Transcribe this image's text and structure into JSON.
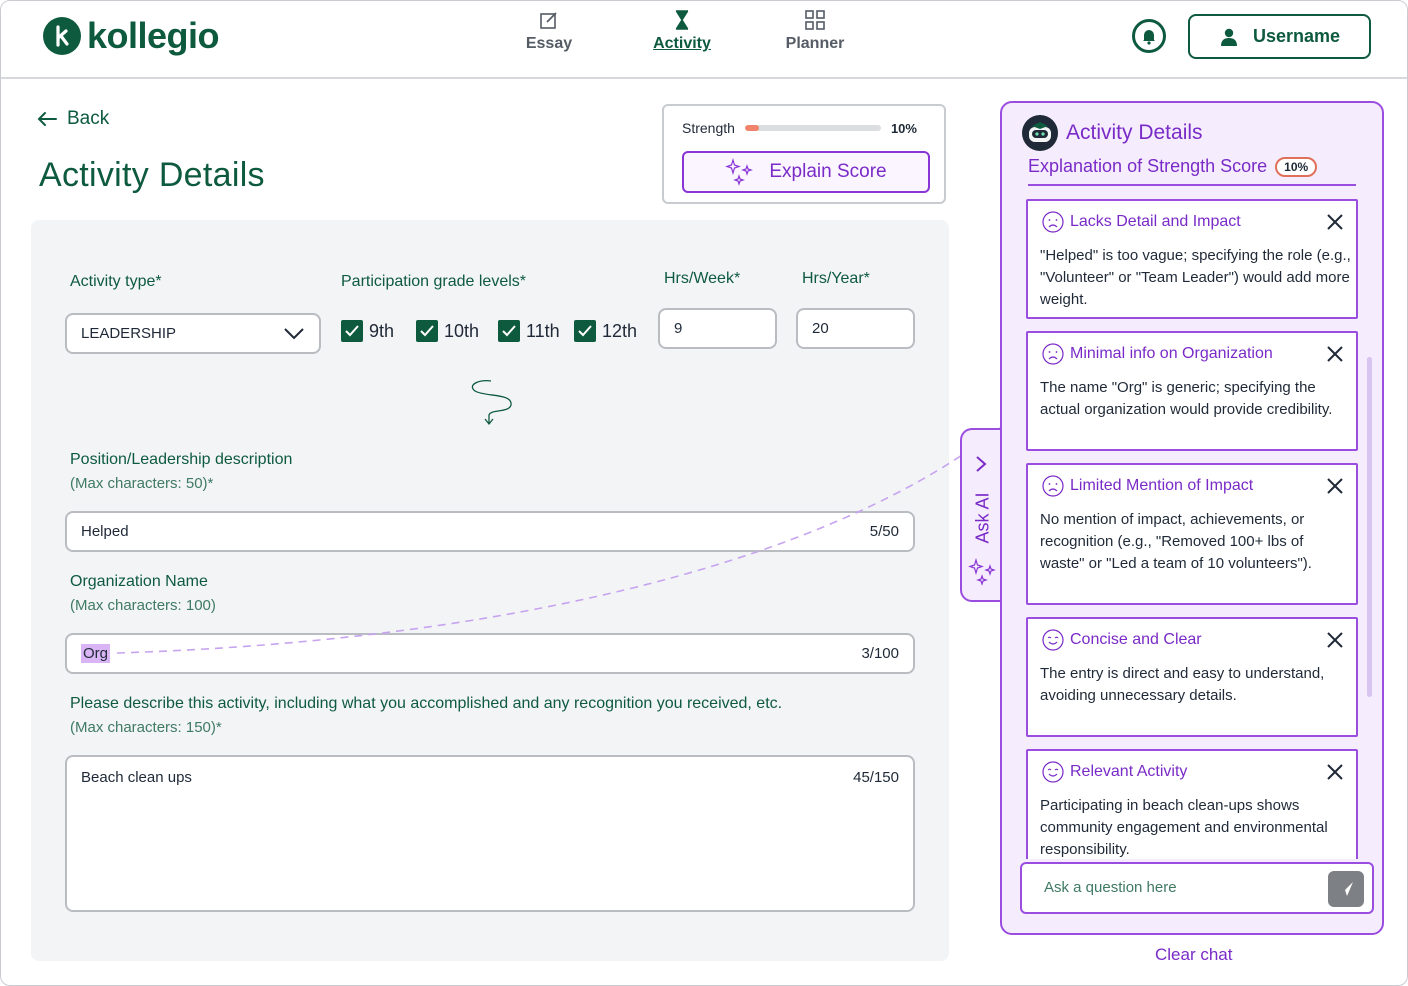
{
  "brand": {
    "name": "kollegio",
    "color": "#0e5a3f"
  },
  "nav": [
    {
      "label": "Essay",
      "icon": "edit-icon",
      "active": false
    },
    {
      "label": "Activity",
      "icon": "hourglass-icon",
      "active": true
    },
    {
      "label": "Planner",
      "icon": "grid-icon",
      "active": false
    }
  ],
  "user": {
    "label": "Username"
  },
  "back_label": "Back",
  "page_title": "Activity Details",
  "strength": {
    "label": "Strength",
    "value_text": "10%",
    "value": 0.1,
    "button": "Explain Score"
  },
  "form": {
    "activity_type_label": "Activity type*",
    "activity_type_value": "LEADERSHIP",
    "grade_label": "Participation grade levels*",
    "grades": [
      {
        "label": "9th",
        "checked": true
      },
      {
        "label": "10th",
        "checked": true
      },
      {
        "label": "11th",
        "checked": true
      },
      {
        "label": "12th",
        "checked": true
      }
    ],
    "hrs_week_label": "Hrs/Week*",
    "hrs_week_value": "9",
    "hrs_year_label": "Hrs/Year*",
    "hrs_year_value": "20",
    "position_label": "Position/Leadership description",
    "position_hint": "(Max characters: 50)*",
    "position_value": "Helped",
    "position_count": "5/50",
    "org_label": "Organization Name",
    "org_hint": "(Max characters: 100)",
    "org_value": "Org",
    "org_count": "3/100",
    "desc_label": "Please describe this activity, including what you accomplished and any recognition you received, etc.",
    "desc_hint": "(Max characters: 150)*",
    "desc_value": "Beach clean ups",
    "desc_count": "45/150"
  },
  "ai": {
    "title": "Activity Details",
    "subtitle": "Explanation of Strength Score",
    "score": "10%",
    "ask_tab": "Ask AI",
    "cards": [
      {
        "title": "Lacks Detail and Impact",
        "mood": "sad",
        "body": "\"Helped\" is too vague; specifying the role (e.g., \"Volunteer\" or \"Team Leader\") would add more weight."
      },
      {
        "title": "Minimal info on Organization",
        "mood": "sad",
        "body": "The name \"Org\" is generic; specifying the actual organization would provide credibility."
      },
      {
        "title": "Limited Mention of Impact",
        "mood": "sad",
        "body": "No mention of impact, achievements, or recognition (e.g., \"Removed 100+ lbs of waste\" or \"Led a team of 10 volunteers\")."
      },
      {
        "title": "Concise and Clear",
        "mood": "happy",
        "body": "The entry is direct and easy to understand, avoiding unnecessary details."
      },
      {
        "title": "Relevant Activity",
        "mood": "happy",
        "body": "Participating in beach clean-ups shows community engagement and environmental responsibility."
      }
    ],
    "ask_placeholder": "Ask a question here",
    "clear_chat": "Clear chat",
    "accent": "#9b4de0"
  }
}
